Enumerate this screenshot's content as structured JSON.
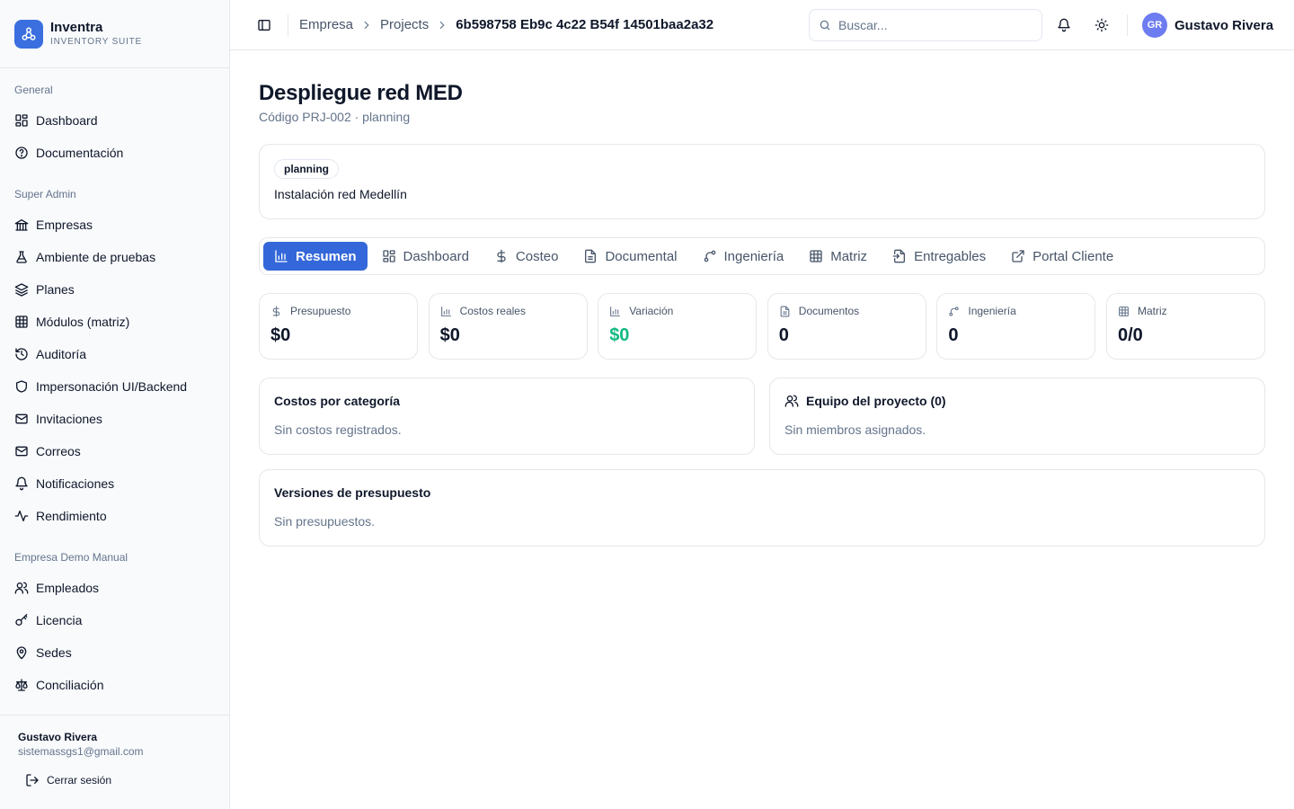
{
  "brand": {
    "name": "Inventra",
    "subtitle": "INVENTORY SUITE",
    "logo_icon": "network-icon",
    "color": "#3b6fe0"
  },
  "sidebar": {
    "groups": [
      {
        "title": "General",
        "items": [
          {
            "label": "Dashboard",
            "icon": "layout-grid-icon"
          },
          {
            "label": "Documentación",
            "icon": "help-circle-icon"
          }
        ]
      },
      {
        "title": "Super Admin",
        "items": [
          {
            "label": "Empresas",
            "icon": "library-icon"
          },
          {
            "label": "Ambiente de pruebas",
            "icon": "flask-icon"
          },
          {
            "label": "Planes",
            "icon": "layers-icon"
          },
          {
            "label": "Módulos (matriz)",
            "icon": "table-icon"
          },
          {
            "label": "Auditoría",
            "icon": "history-icon"
          },
          {
            "label": "Impersonación UI/Backend",
            "icon": "shield-icon"
          },
          {
            "label": "Invitaciones",
            "icon": "mail-icon"
          },
          {
            "label": "Correos",
            "icon": "mail-icon"
          },
          {
            "label": "Notificaciones",
            "icon": "bell-icon"
          },
          {
            "label": "Rendimiento",
            "icon": "activity-icon"
          }
        ]
      },
      {
        "title": "Empresa Demo Manual",
        "items": [
          {
            "label": "Empleados",
            "icon": "users-icon"
          },
          {
            "label": "Licencia",
            "icon": "key-icon"
          },
          {
            "label": "Sedes",
            "icon": "map-pin-icon"
          },
          {
            "label": "Conciliación",
            "icon": "scale-icon"
          }
        ]
      }
    ],
    "footer": {
      "user_name": "Gustavo Rivera",
      "user_email": "sistemassgs1@gmail.com",
      "logout_label": "Cerrar sesión"
    }
  },
  "header": {
    "breadcrumb": [
      "Empresa",
      "Projects",
      "6b598758 Eb9c 4c22 B54f 14501baa2a32"
    ],
    "search_placeholder": "Buscar...",
    "user": {
      "initials": "GR",
      "name": "Gustavo Rivera",
      "avatar_color": "#6d7cf0"
    }
  },
  "project": {
    "title": "Despliegue red MED",
    "subtitle": "Código PRJ-002 · planning",
    "status_badge": "planning",
    "description": "Instalación red Medellín"
  },
  "tabs": [
    {
      "label": "Resumen",
      "icon": "bar-chart-icon",
      "active": true
    },
    {
      "label": "Dashboard",
      "icon": "layout-grid-icon",
      "active": false
    },
    {
      "label": "Costeo",
      "icon": "dollar-icon",
      "active": false
    },
    {
      "label": "Documental",
      "icon": "file-text-icon",
      "active": false
    },
    {
      "label": "Ingeniería",
      "icon": "git-branch-icon",
      "active": false
    },
    {
      "label": "Matriz",
      "icon": "table-icon",
      "active": false
    },
    {
      "label": "Entregables",
      "icon": "file-export-icon",
      "active": false
    },
    {
      "label": "Portal Cliente",
      "icon": "external-link-icon",
      "active": false
    }
  ],
  "accent_color": "#3467d9",
  "stats": [
    {
      "label": "Presupuesto",
      "value": "$0",
      "icon": "dollar-icon"
    },
    {
      "label": "Costos reales",
      "value": "$0",
      "icon": "bar-chart-icon"
    },
    {
      "label": "Variación",
      "value": "$0",
      "icon": "bar-chart-icon",
      "color": "#10b981"
    },
    {
      "label": "Documentos",
      "value": "0",
      "icon": "file-text-icon"
    },
    {
      "label": "Ingeniería",
      "value": "0",
      "icon": "git-branch-icon"
    },
    {
      "label": "Matriz",
      "value": "0/0",
      "icon": "table-icon"
    }
  ],
  "panels": {
    "costs": {
      "title": "Costos por categoría",
      "empty": "Sin costos registrados."
    },
    "team": {
      "title": "Equipo del proyecto (0)",
      "empty": "Sin miembros asignados.",
      "icon": "users-icon"
    },
    "budget_versions": {
      "title": "Versiones de presupuesto",
      "empty": "Sin presupuestos."
    }
  }
}
